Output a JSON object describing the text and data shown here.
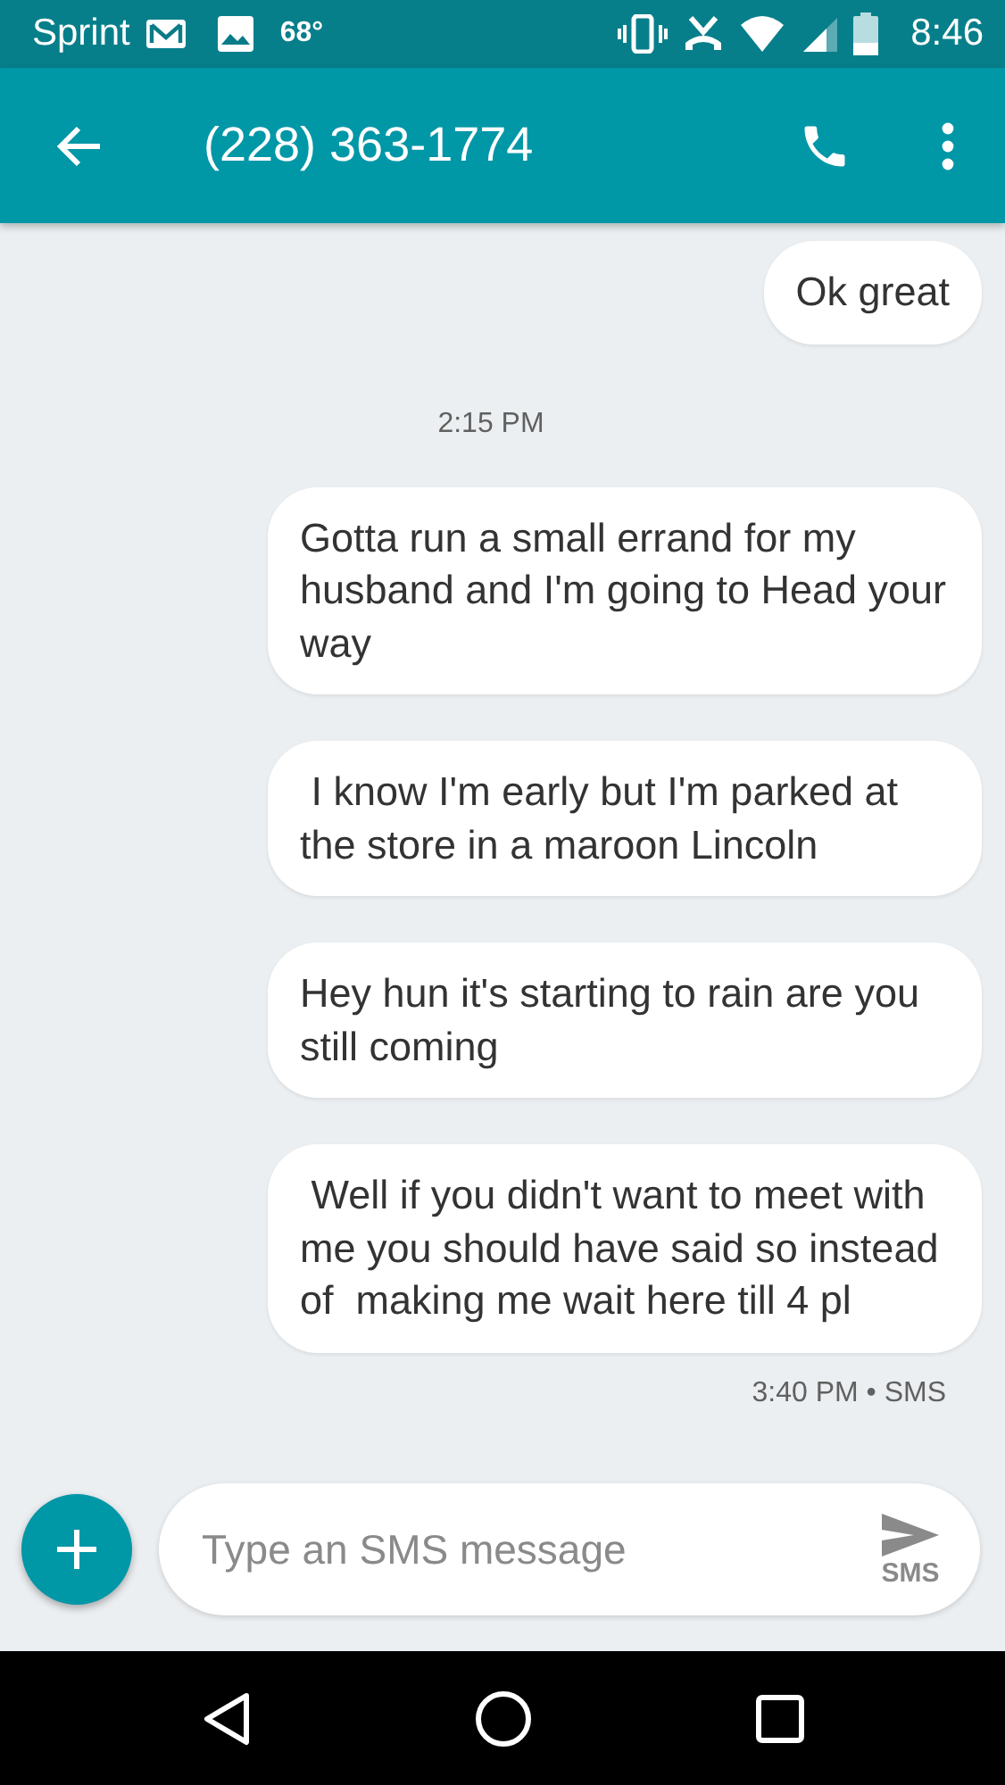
{
  "status_bar": {
    "carrier": "Sprint",
    "temperature": "68°",
    "time": "8:46"
  },
  "toolbar": {
    "title": "(228) 363-1774"
  },
  "messages": [
    {
      "kind": "message",
      "text": "Ok great"
    },
    {
      "kind": "timestamp",
      "text": "2:15 PM"
    },
    {
      "kind": "message",
      "text": "Gotta run a small errand for my husband and I'm going to Head your way"
    },
    {
      "kind": "message",
      "text": " I know I'm early but I'm parked at the store in a maroon Lincoln"
    },
    {
      "kind": "message",
      "text": "Hey hun it's starting to rain are you still coming"
    },
    {
      "kind": "message",
      "text": " Well if you didn't want to meet with me you should have said so instead of  making me wait here till 4 pl"
    },
    {
      "kind": "meta",
      "text": "3:40 PM • SMS"
    }
  ],
  "composer": {
    "placeholder": "Type an SMS message",
    "send_label": "SMS"
  }
}
